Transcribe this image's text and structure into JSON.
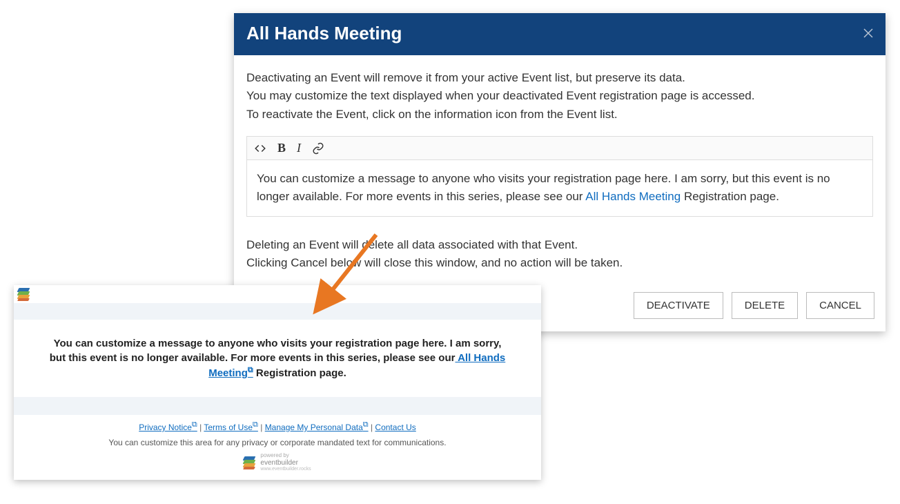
{
  "modal": {
    "title": "All Hands Meeting",
    "intro": {
      "line1": "Deactivating an Event will remove it from your active Event list, but preserve its data.",
      "line2": "You may customize the text displayed when your deactivated Event registration page is accessed.",
      "line3": "To reactivate the Event, click on the information icon from the Event list."
    },
    "editor": {
      "content_before": "You can customize a message to anyone who visits your registration page here.  I am sorry, but this event is no longer available.  For more events in this series, please see our ",
      "link_text": "All Hands Meeting",
      "content_after": " Registration page."
    },
    "post": {
      "line1": "Deleting an Event will delete all data associated with that Event.",
      "line2": "Clicking Cancel below will close this window, and no action will be taken."
    },
    "buttons": {
      "deactivate": "DEACTIVATE",
      "delete": "DELETE",
      "cancel": "CANCEL"
    }
  },
  "preview": {
    "message_before": "You can customize a message to anyone who visits your registration page here.  I am sorry, but this event is no longer available.  For more events in this series, please see our",
    "link_text": " All Hands Meeting",
    "message_after": " Registration page.",
    "footer": {
      "links": {
        "privacy": "Privacy Notice",
        "terms": "Terms of Use",
        "manage": "Manage My Personal Data",
        "contact": "Contact Us"
      },
      "separator": " | ",
      "disclaimer": "You can customize this area for any privacy or corporate mandated text for communications.",
      "powered_label": "powered by",
      "powered_brand": "eventbuilder",
      "powered_url": "www.eventbuilder.rocks"
    }
  },
  "colors": {
    "accent": "#12437c",
    "link": "#0f6cbf",
    "arrow": "#e87722"
  }
}
